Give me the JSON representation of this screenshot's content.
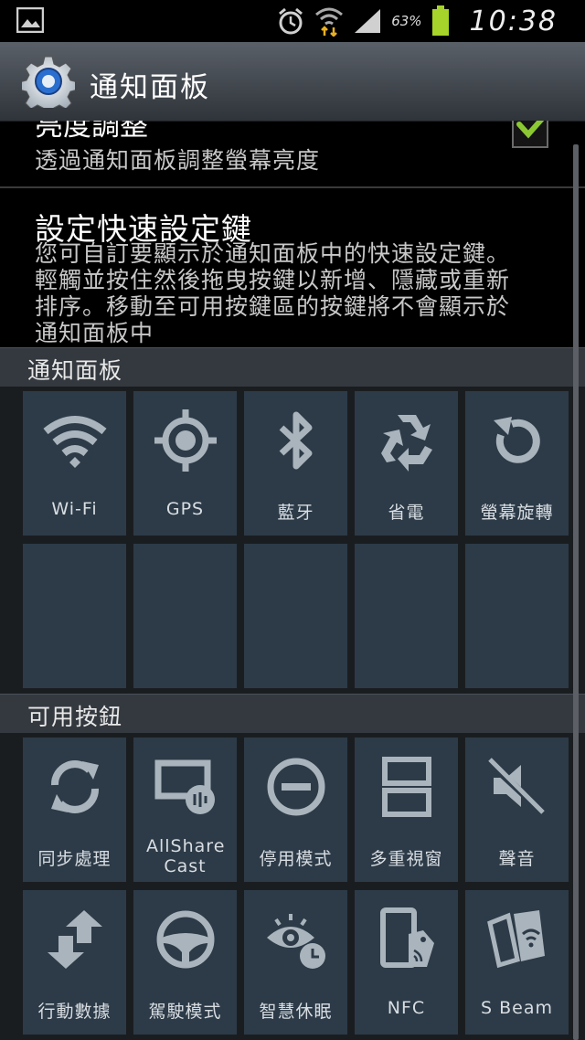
{
  "status_bar": {
    "battery_percent": "63%",
    "time": "10:38"
  },
  "action_bar": {
    "title": "通知面板"
  },
  "settings": {
    "brightness": {
      "title": "亮度調整",
      "summary": "透過通知面板調整螢幕亮度",
      "checked": true
    },
    "quick_keys": {
      "title": "設定快速設定鍵",
      "summary": "您可自訂要顯示於通知面板中的快速設定鍵。輕觸並按住然後拖曳按鍵以新增、隱藏或重新排序。移動至可用按鍵區的按鍵將不會顯示於通知面板中"
    }
  },
  "panel_section": {
    "header": "通知面板",
    "buttons": [
      {
        "label": "Wi-Fi",
        "icon": "wifi-icon"
      },
      {
        "label": "GPS",
        "icon": "gps-icon"
      },
      {
        "label": "藍牙",
        "icon": "bluetooth-icon"
      },
      {
        "label": "省電",
        "icon": "recycle-icon"
      },
      {
        "label": "螢幕旋轉",
        "icon": "rotate-icon"
      }
    ]
  },
  "available_section": {
    "header": "可用按鈕",
    "buttons": [
      {
        "label": "同步處理",
        "icon": "sync-icon"
      },
      {
        "label": "AllShare Cast",
        "icon": "allshare-cast-icon"
      },
      {
        "label": "停用模式",
        "icon": "block-icon"
      },
      {
        "label": "多重視窗",
        "icon": "multi-window-icon"
      },
      {
        "label": "聲音",
        "icon": "mute-icon"
      },
      {
        "label": "行動數據",
        "icon": "mobile-data-icon"
      },
      {
        "label": "駕駛模式",
        "icon": "steering-wheel-icon"
      },
      {
        "label": "智慧休眠",
        "icon": "smart-stay-icon"
      },
      {
        "label": "NFC",
        "icon": "nfc-icon"
      },
      {
        "label": "S Beam",
        "icon": "s-beam-icon"
      }
    ]
  },
  "colors": {
    "tile": "#2d3b48",
    "icon": "#aab4bd",
    "check": "#8bc832",
    "header": "#34393f"
  }
}
